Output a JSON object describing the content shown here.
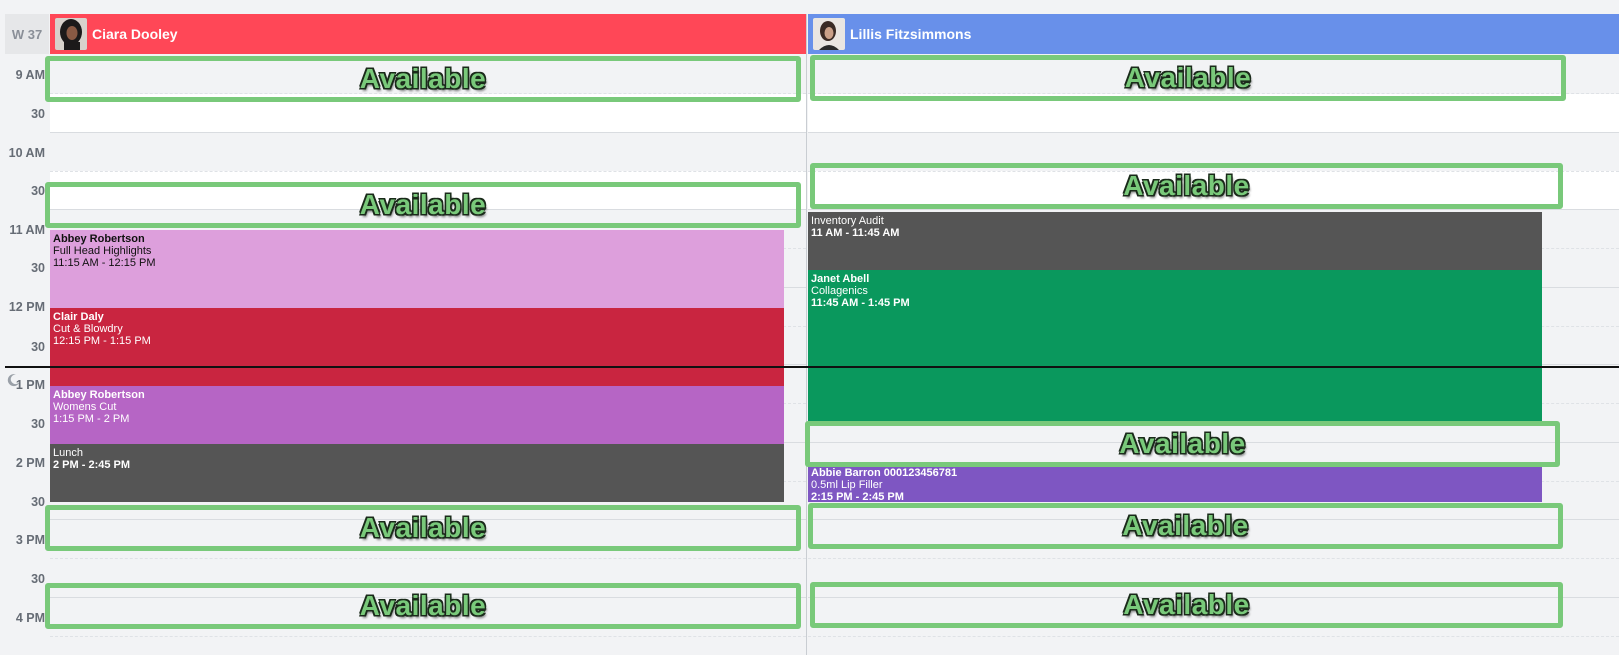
{
  "week_label": "W 37",
  "staff": [
    {
      "name": "Ciara Dooley",
      "color": "#ff4757"
    },
    {
      "name": "Lillis Fitzsimmons",
      "color": "#6890ea"
    }
  ],
  "time_labels": [
    "9 AM",
    "30",
    "10 AM",
    "30",
    "11 AM",
    "30",
    "12 PM",
    "30",
    "1 PM",
    "30",
    "2 PM",
    "30",
    "3 PM",
    "30",
    "4 PM"
  ],
  "events_col1": [
    {
      "title": "Abbey Robertson",
      "service": "Full Head Highlights",
      "time": "11:15 AM - 12:15 PM",
      "color": "#dd9fdc",
      "text": "#111"
    },
    {
      "title": "Clair Daly",
      "service": "Cut & Blowdry",
      "time": "12:15 PM - 1:15 PM",
      "color": "#c92540",
      "text": "#fff"
    },
    {
      "title": "Abbey Robertson",
      "service": "Womens Cut",
      "time": "1:15 PM - 2 PM",
      "color": "#b665c5",
      "text": "#fff"
    },
    {
      "title": "Lunch",
      "service": "",
      "time": "2 PM - 2:45 PM",
      "color": "#555555",
      "text": "#fff"
    }
  ],
  "events_col2": [
    {
      "title": "Inventory Audit",
      "service": "",
      "time": "11 AM - 11:45 AM",
      "color": "#555555",
      "text": "#fff"
    },
    {
      "title": "Janet Abell",
      "service": "Collagenics",
      "time": "11:45 AM - 1:45 PM",
      "color": "#0a985d",
      "text": "#fff"
    },
    {
      "title": "Abbie Barron 000123456781",
      "service": "0.5ml Lip Filler",
      "time": "2:15 PM - 2:45 PM",
      "color": "#7e56c2",
      "text": "#fff"
    }
  ],
  "available_label": "Available"
}
